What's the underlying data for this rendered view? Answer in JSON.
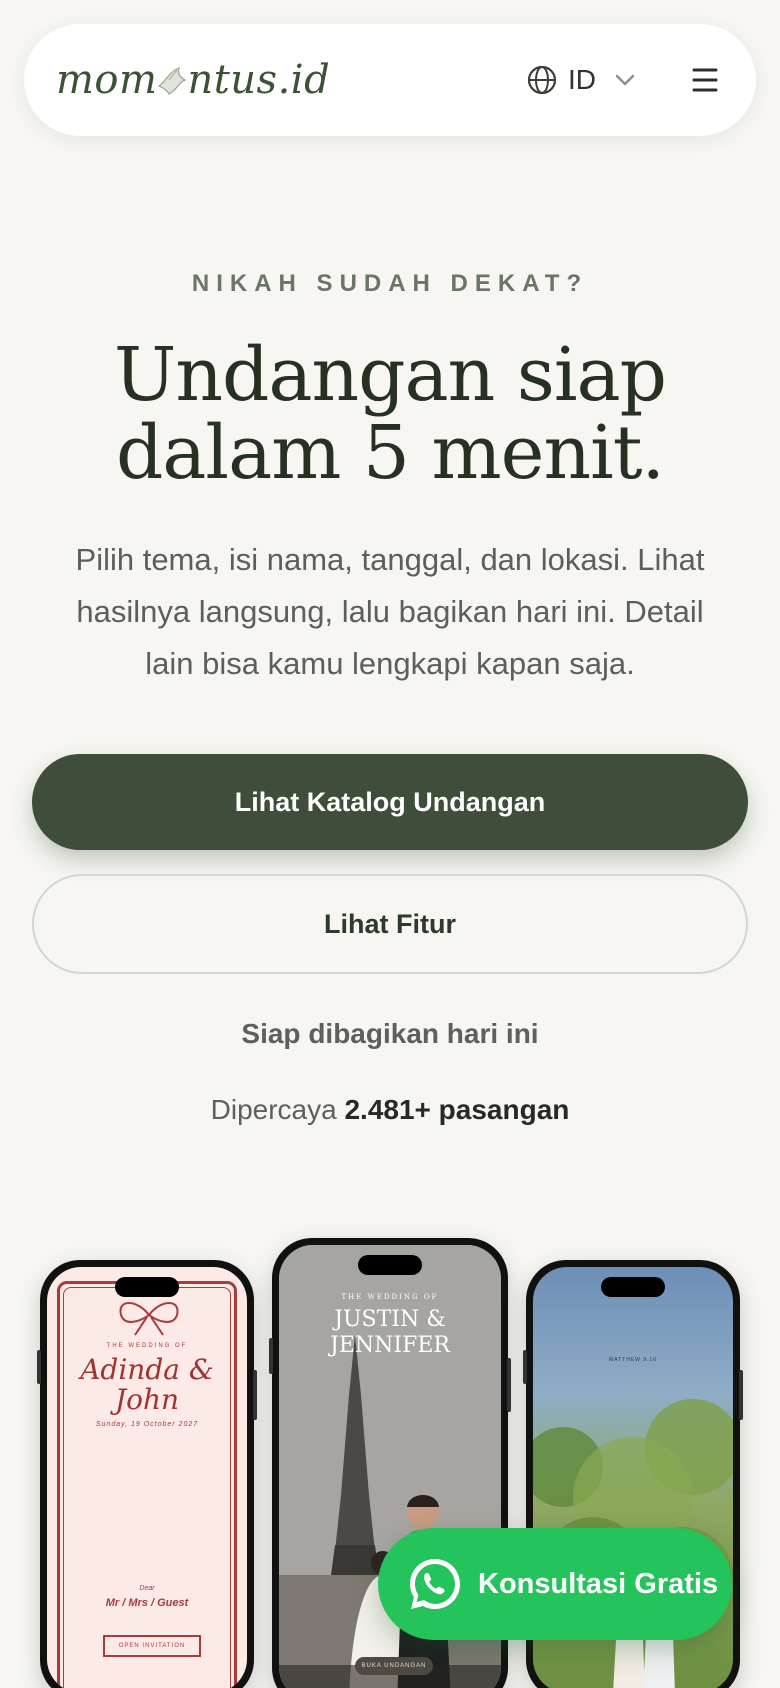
{
  "header": {
    "logo_text_before": "mom",
    "logo_text_after": "ntus.id",
    "logo_icon": "dove-icon",
    "language_code": "ID",
    "language_icon": "globe-icon",
    "menu_icon": "hamburger-menu-icon"
  },
  "hero": {
    "eyebrow": "NIKAH SUDAH DEKAT?",
    "headline_line1": "Undangan siap",
    "headline_line2": "dalam 5 menit.",
    "lead": "Pilih tema, isi nama, tanggal, dan lokasi. Lihat hasilnya langsung, lalu bagikan hari ini. Detail lain bisa kamu lengkapi kapan saja.",
    "primary_button": "Lihat Katalog Undangan",
    "secondary_button": "Lihat Fitur",
    "ready_text": "Siap dibagikan hari ini",
    "trusted_prefix": "Dipercaya",
    "trusted_count": "2.481+ pasangan"
  },
  "previews": {
    "left": {
      "small_caption": "THE WEDDING OF",
      "names_line1": "Adinda &",
      "names_line2": "John",
      "date": "Sunday, 19 October 2027",
      "dear": "Dear",
      "guest": "Mr / Mrs / Guest",
      "button": "OPEN INVITATION"
    },
    "center": {
      "small_caption": "THE WEDDING OF",
      "names_line1": "JUSTIN &",
      "names_line2": "JENNIFER",
      "button": "BUKA UNDANGAN"
    },
    "right": {
      "quote_author": "MATTHEW 9:16"
    }
  },
  "whatsapp": {
    "label": "Konsultasi Gratis",
    "icon": "whatsapp-icon",
    "color": "#25c35b"
  },
  "colors": {
    "background": "#f7f6f2",
    "primary": "#3e4e3a",
    "logo": "#3b5234"
  }
}
